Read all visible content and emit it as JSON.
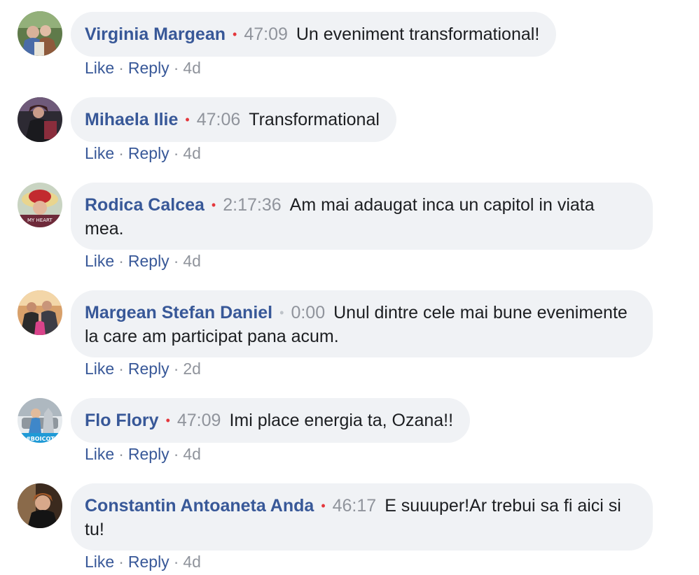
{
  "comments": [
    {
      "author": "Virginia Margean",
      "timestamp": "47:09",
      "text": "Un eveniment transformational!",
      "like": "Like",
      "reply": "Reply",
      "age": "4d"
    },
    {
      "author": "Mihaela Ilie",
      "timestamp": "47:06",
      "text": "Transformational",
      "like": "Like",
      "reply": "Reply",
      "age": "4d"
    },
    {
      "author": "Rodica Calcea",
      "timestamp": "2:17:36",
      "text": "Am mai adaugat inca un capitol in viata mea.",
      "like": "Like",
      "reply": "Reply",
      "age": "4d"
    },
    {
      "author": "Margean Stefan Daniel",
      "timestamp": "0:00",
      "text": "Unul dintre cele mai bune evenimente la care am participat pana acum.",
      "like": "Like",
      "reply": "Reply",
      "age": "2d"
    },
    {
      "author": "Flo Flory",
      "timestamp": "47:09",
      "text": "Imi place energia ta, Ozana!!",
      "like": "Like",
      "reply": "Reply",
      "age": "4d"
    },
    {
      "author": "Constantin Antoaneta Anda",
      "timestamp": "46:17",
      "text": "E suuuper!Ar trebui sa fi aici si tu!",
      "like": "Like",
      "reply": "Reply",
      "age": "4d"
    }
  ],
  "colors": {
    "author": "#385898",
    "timestamp": "#90949c",
    "dot_live": "#e4373c",
    "dot_muted": "#bec3c9",
    "bubble": "#f0f2f5"
  },
  "avatar_badges": {
    "rodica": "MY HEART",
    "flo": "#BOICOT"
  }
}
